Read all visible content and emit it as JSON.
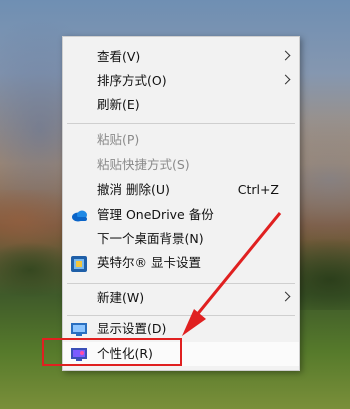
{
  "menu": {
    "items": [
      {
        "label": "查看(V)",
        "submenu": true
      },
      {
        "label": "排序方式(O)",
        "submenu": true
      },
      {
        "label": "刷新(E)"
      },
      {
        "label": "粘贴(P)",
        "disabled": true
      },
      {
        "label": "粘贴快捷方式(S)",
        "disabled": true
      },
      {
        "label": "撤消 删除(U)",
        "shortcut": "Ctrl+Z"
      },
      {
        "label": "管理 OneDrive 备份",
        "icon": "onedrive-cloud-icon"
      },
      {
        "label": "下一个桌面背景(N)"
      },
      {
        "label": "英特尔® 显卡设置",
        "icon": "intel-graphics-icon"
      },
      {
        "label": "新建(W)",
        "submenu": true
      },
      {
        "label": "显示设置(D)",
        "icon": "display-settings-icon"
      },
      {
        "label": "个性化(R)",
        "icon": "personalize-icon"
      }
    ]
  },
  "annotation": {
    "color": "#e02020",
    "target": "个性化(R)"
  }
}
